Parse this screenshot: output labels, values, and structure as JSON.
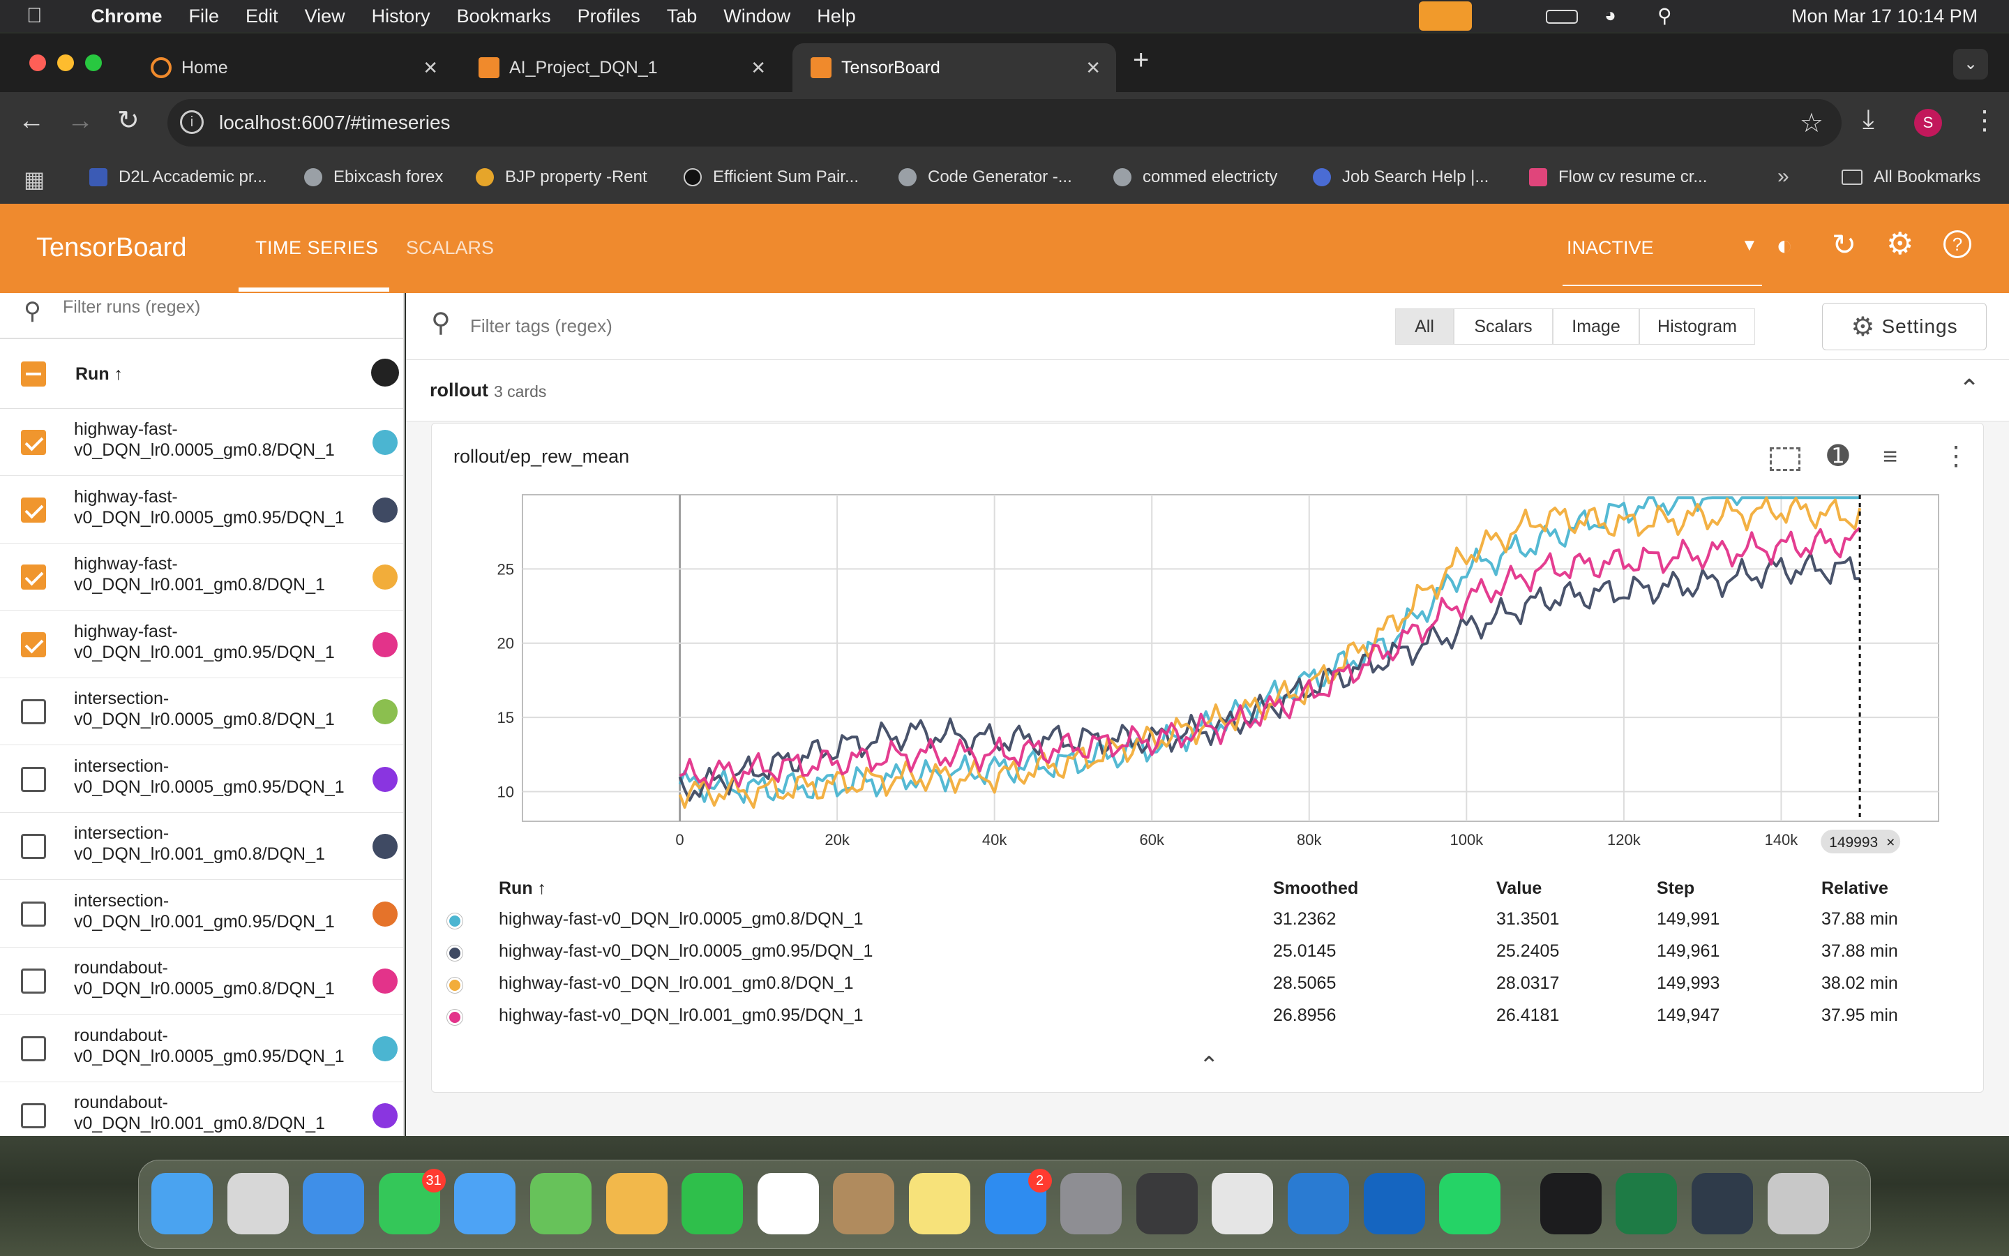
{
  "menubar": {
    "app": "Chrome",
    "items": [
      "File",
      "Edit",
      "View",
      "History",
      "Bookmarks",
      "Profiles",
      "Tab",
      "Window",
      "Help"
    ],
    "clock": "Mon Mar 17  10:14 PM"
  },
  "tabs": [
    {
      "label": "Home"
    },
    {
      "label": "AI_Project_DQN_1"
    },
    {
      "label": "TensorBoard"
    }
  ],
  "address": {
    "url": "localhost:6007/#timeseries",
    "profile": "S"
  },
  "bookmarks": [
    "D2L Accademic pr...",
    "Ebixcash forex",
    "BJP property -Rent",
    "Efficient Sum Pair...",
    "Code Generator -...",
    "commed electricty",
    "Job Search Help |...",
    "Flow cv resume cr..."
  ],
  "all_bookmarks": "All Bookmarks",
  "tb": {
    "brand": "TensorBoard",
    "tabs": [
      "TIME SERIES",
      "SCALARS"
    ],
    "status": "INACTIVE"
  },
  "sidebar": {
    "filter_placeholder": "Filter runs (regex)",
    "run_header": "Run ↑",
    "runs": [
      {
        "l1": "highway-fast-",
        "l2": "v0_DQN_lr0.0005_gm0.8/DQN_1",
        "checked": true,
        "color": "#4bb5d1"
      },
      {
        "l1": "highway-fast-",
        "l2": "v0_DQN_lr0.0005_gm0.95/DQN_1",
        "checked": true,
        "color": "#3f4a63"
      },
      {
        "l1": "highway-fast-",
        "l2": "v0_DQN_lr0.001_gm0.8/DQN_1",
        "checked": true,
        "color": "#f2ad3a"
      },
      {
        "l1": "highway-fast-",
        "l2": "v0_DQN_lr0.001_gm0.95/DQN_1",
        "checked": true,
        "color": "#e3338a"
      },
      {
        "l1": "intersection-",
        "l2": "v0_DQN_lr0.0005_gm0.8/DQN_1",
        "checked": false,
        "color": "#8bbf4f"
      },
      {
        "l1": "intersection-",
        "l2": "v0_DQN_lr0.0005_gm0.95/DQN_1",
        "checked": false,
        "color": "#8a35e0"
      },
      {
        "l1": "intersection-",
        "l2": "v0_DQN_lr0.001_gm0.8/DQN_1",
        "checked": false,
        "color": "#3f4a63"
      },
      {
        "l1": "intersection-",
        "l2": "v0_DQN_lr0.001_gm0.95/DQN_1",
        "checked": false,
        "color": "#e5732a"
      },
      {
        "l1": "roundabout-",
        "l2": "v0_DQN_lr0.0005_gm0.8/DQN_1",
        "checked": false,
        "color": "#e3338a"
      },
      {
        "l1": "roundabout-",
        "l2": "v0_DQN_lr0.0005_gm0.95/DQN_1",
        "checked": false,
        "color": "#4bb5d1"
      },
      {
        "l1": "roundabout-",
        "l2": "v0_DQN_lr0.001_gm0.8/DQN_1",
        "checked": false,
        "color": "#8a35e0"
      }
    ]
  },
  "main": {
    "filter_placeholder": "Filter tags (regex)",
    "chips": [
      "All",
      "Scalars",
      "Image",
      "Histogram"
    ],
    "settings": "Settings",
    "group": "rollout",
    "group_count": "3 cards",
    "card_title": "rollout/ep_rew_mean",
    "step_marker": "149993"
  },
  "legend": {
    "headers": [
      "Run ↑",
      "Smoothed",
      "Value",
      "Step",
      "Relative"
    ],
    "rows": [
      {
        "run": "highway-fast-v0_DQN_lr0.0005_gm0.8/DQN_1",
        "smoothed": "31.2362",
        "value": "31.3501",
        "step": "149,991",
        "relative": "37.88 min",
        "color": "#4bb5d1"
      },
      {
        "run": "highway-fast-v0_DQN_lr0.0005_gm0.95/DQN_1",
        "smoothed": "25.0145",
        "value": "25.2405",
        "step": "149,961",
        "relative": "37.88 min",
        "color": "#3f4a63"
      },
      {
        "run": "highway-fast-v0_DQN_lr0.001_gm0.8/DQN_1",
        "smoothed": "28.5065",
        "value": "28.0317",
        "step": "149,993",
        "relative": "38.02 min",
        "color": "#f2ad3a"
      },
      {
        "run": "highway-fast-v0_DQN_lr0.001_gm0.95/DQN_1",
        "smoothed": "26.8956",
        "value": "26.4181",
        "step": "149,947",
        "relative": "37.95 min",
        "color": "#e3338a"
      }
    ]
  },
  "chart_data": {
    "type": "line",
    "title": "rollout/ep_rew_mean",
    "xlim": [
      -20000,
      160000
    ],
    "ylim": [
      8,
      30
    ],
    "x_ticks": [
      "0",
      "20k",
      "40k",
      "60k",
      "80k",
      "100k",
      "120k",
      "140k"
    ],
    "y_ticks": [
      "10",
      "15",
      "20",
      "25"
    ],
    "series": [
      {
        "name": "highway-fast-v0_DQN_lr0.0005_gm0.8/DQN_1",
        "color": "#4bb5d1",
        "x": [
          0,
          10000,
          20000,
          30000,
          40000,
          50000,
          60000,
          70000,
          80000,
          90000,
          100000,
          110000,
          120000,
          130000,
          140000,
          150000
        ],
        "y": [
          10.5,
          10.2,
          10.5,
          11,
          11.5,
          12,
          13,
          15,
          17.5,
          20,
          25,
          27,
          29,
          30,
          31,
          31.2
        ]
      },
      {
        "name": "highway-fast-v0_DQN_lr0.0005_gm0.95/DQN_1",
        "color": "#3f4a63",
        "x": [
          0,
          10000,
          20000,
          30000,
          40000,
          50000,
          60000,
          70000,
          80000,
          90000,
          100000,
          110000,
          120000,
          130000,
          140000,
          150000
        ],
        "y": [
          10,
          11.5,
          13,
          14,
          13.5,
          13.5,
          13.5,
          14.5,
          17,
          19,
          21,
          23,
          23.5,
          24,
          25,
          25
        ]
      },
      {
        "name": "highway-fast-v0_DQN_lr0.001_gm0.8/DQN_1",
        "color": "#f2ad3a",
        "x": [
          0,
          10000,
          20000,
          30000,
          40000,
          50000,
          60000,
          70000,
          80000,
          90000,
          100000,
          110000,
          120000,
          130000,
          140000,
          150000
        ],
        "y": [
          10,
          10,
          10.5,
          11,
          11,
          12,
          13.5,
          15,
          17,
          21,
          26,
          28.5,
          28,
          28.5,
          29,
          28.5
        ]
      },
      {
        "name": "highway-fast-v0_DQN_lr0.001_gm0.95/DQN_1",
        "color": "#e3338a",
        "x": [
          0,
          10000,
          20000,
          30000,
          40000,
          50000,
          60000,
          70000,
          80000,
          90000,
          100000,
          110000,
          120000,
          130000,
          140000,
          150000
        ],
        "y": [
          11,
          11.5,
          12,
          12.5,
          12.5,
          13,
          13.5,
          14.5,
          16.5,
          19.5,
          23,
          25,
          25.5,
          26,
          26.5,
          26.9
        ]
      }
    ]
  }
}
